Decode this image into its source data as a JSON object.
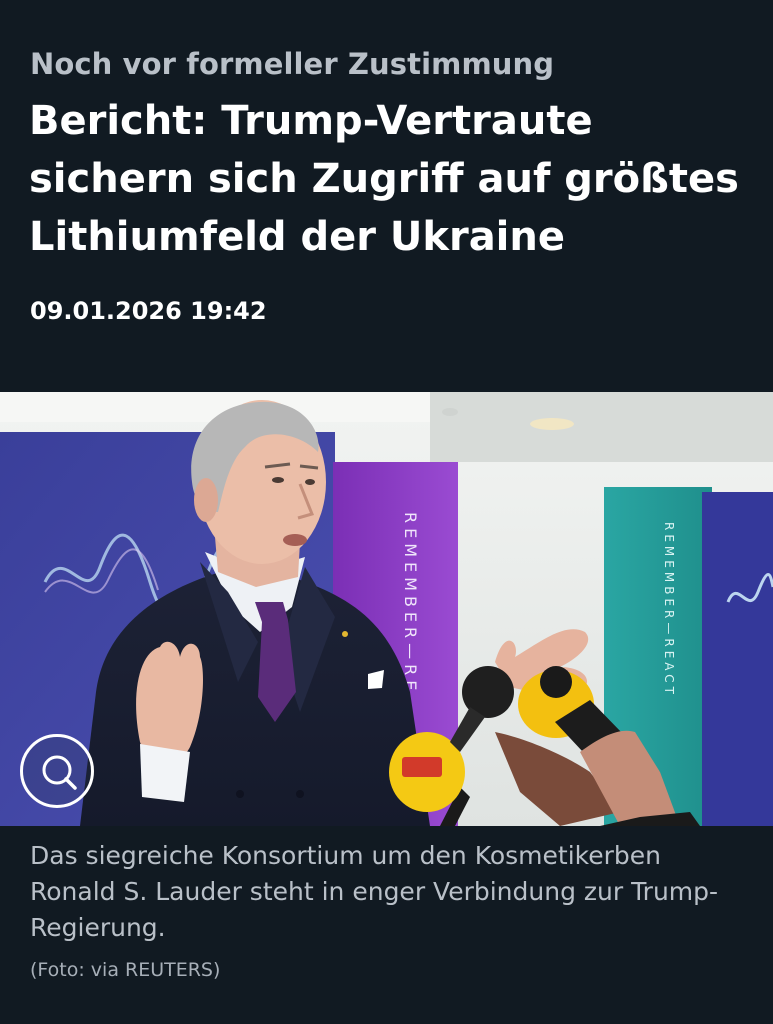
{
  "article": {
    "kicker": "Noch vor formeller Zustimmung",
    "headline": "Bericht: Trump-Vertraute sichern sich Zugriff auf größtes Lithiumfeld der Ukraine",
    "timestamp": "09.01.2026 19:42"
  },
  "image": {
    "zoom_icon": "search-icon",
    "banner_text_left": "REMEMBER—RE",
    "banner_text_right": "REMEMBER—REACT",
    "caption": "Das siegreiche Konsortium um den Kosmetikerben Ronald S. Lauder steht in enger Verbindung zur Trump-Regierung.",
    "credit": "(Foto: via REUTERS)"
  },
  "colors": {
    "background": "#111a22",
    "headline": "#ffffff",
    "kicker": "#b9c0c8",
    "caption": "#b9c0c8"
  }
}
